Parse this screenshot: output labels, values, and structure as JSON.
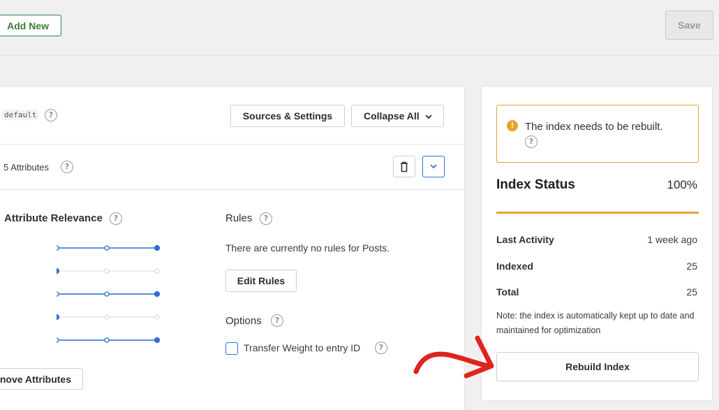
{
  "toolbar": {
    "add_new_label": "Add New",
    "save_label": "Save"
  },
  "engine": {
    "name_code": "default",
    "sources_settings_label": "Sources & Settings",
    "collapse_all_label": "Collapse All"
  },
  "source": {
    "attribute_count_label": "5 Attributes"
  },
  "relevance": {
    "title": "Attribute Relevance",
    "sliders": [
      1.0,
      0.0,
      1.0,
      0.0,
      1.0
    ],
    "remove_attributes_label": "nove Attributes"
  },
  "rules": {
    "title": "Rules",
    "empty_text": "There are currently no rules for Posts.",
    "edit_label": "Edit Rules"
  },
  "options": {
    "title": "Options",
    "transfer_weight_label": "Transfer Weight to entry ID",
    "transfer_weight_checked": false
  },
  "index": {
    "notice": "The index needs to be rebuilt.",
    "status_title": "Index Status",
    "percent_label": "100%",
    "progress": 1.0,
    "stats": [
      {
        "label": "Last Activity",
        "value": "1 week ago"
      },
      {
        "label": "Indexed",
        "value": "25"
      },
      {
        "label": "Total",
        "value": "25"
      }
    ],
    "note": "Note: the index is automatically kept up to date and maintained for optimization",
    "rebuild_label": "Rebuild Index"
  },
  "colors": {
    "accent_blue": "#2f6fd6",
    "warning_orange": "#e8a23a",
    "annotation_red": "#e0231d",
    "add_green": "#3d7a3d"
  },
  "icons": {
    "help": "question-circle-icon",
    "trash": "trash-icon",
    "chevron": "chevron-down-icon",
    "warning": "exclamation-icon",
    "annotation": "curved-arrow-icon"
  }
}
